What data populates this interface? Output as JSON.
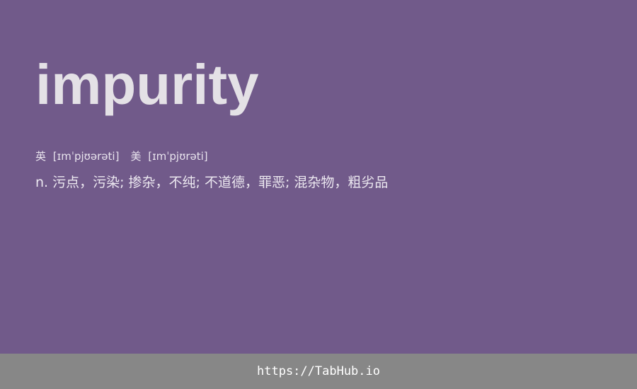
{
  "entry": {
    "word": "impurity",
    "phonetics": {
      "uk": {
        "label": "英",
        "ipa": "[ɪmˈpjʊərəti]"
      },
      "us": {
        "label": "美",
        "ipa": "[ɪmˈpjʊrəti]"
      }
    },
    "definition": {
      "pos": "n.",
      "text": "污点，污染; 掺杂，不纯; 不道德，罪恶; 混杂物，粗劣品"
    }
  },
  "footer": {
    "link": "https://TabHub.io"
  },
  "colors": {
    "background": "#715a8a",
    "footer": "#878787",
    "word": "#e4e1e6"
  }
}
